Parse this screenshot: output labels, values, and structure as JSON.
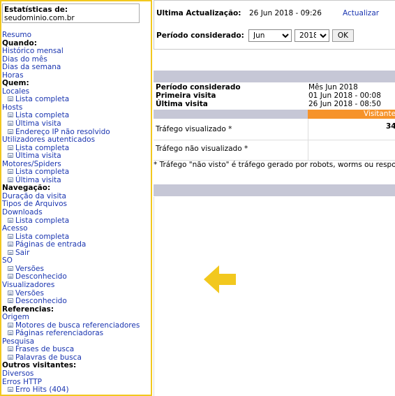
{
  "nav": {
    "title": "Estatísticas de:",
    "site": "seudominio.com.br",
    "items": [
      {
        "t": "Resumo",
        "k": "link"
      },
      {
        "t": "Quando:",
        "k": "h"
      },
      {
        "t": "Histórico mensal",
        "k": "link"
      },
      {
        "t": "Dias do mês",
        "k": "link"
      },
      {
        "t": "Dias da semana",
        "k": "link"
      },
      {
        "t": "Horas",
        "k": "link"
      },
      {
        "t": "Quem:",
        "k": "h"
      },
      {
        "t": "Locales",
        "k": "link"
      },
      {
        "t": "Lista completa",
        "k": "sub"
      },
      {
        "t": "Hosts",
        "k": "link"
      },
      {
        "t": "Lista completa",
        "k": "sub"
      },
      {
        "t": "Última visita",
        "k": "sub"
      },
      {
        "t": "Endereço IP não resolvido",
        "k": "sub"
      },
      {
        "t": "Utilizadores autenticados",
        "k": "link"
      },
      {
        "t": "Lista completa",
        "k": "sub"
      },
      {
        "t": "Última visita",
        "k": "sub"
      },
      {
        "t": "Motores/Spiders",
        "k": "link"
      },
      {
        "t": "Lista completa",
        "k": "sub"
      },
      {
        "t": "Última visita",
        "k": "sub"
      },
      {
        "t": "Navegação:",
        "k": "h"
      },
      {
        "t": "Duração da visita",
        "k": "link"
      },
      {
        "t": "Tipos de Arquivos",
        "k": "link"
      },
      {
        "t": "Downloads",
        "k": "link"
      },
      {
        "t": "Lista completa",
        "k": "sub"
      },
      {
        "t": "Acesso",
        "k": "link"
      },
      {
        "t": "Lista completa",
        "k": "sub"
      },
      {
        "t": "Páginas de entrada",
        "k": "sub"
      },
      {
        "t": "Sair",
        "k": "sub"
      },
      {
        "t": "SO",
        "k": "link"
      },
      {
        "t": "Versões",
        "k": "sub"
      },
      {
        "t": "Desconhecido",
        "k": "sub"
      },
      {
        "t": "Visualizadores",
        "k": "link"
      },
      {
        "t": "Versões",
        "k": "sub"
      },
      {
        "t": "Desconhecido",
        "k": "sub"
      },
      {
        "t": "Referencias:",
        "k": "h"
      },
      {
        "t": "Origem",
        "k": "link"
      },
      {
        "t": "Motores de busca referenciadores",
        "k": "sub"
      },
      {
        "t": "Páginas referenciadoras",
        "k": "sub"
      },
      {
        "t": "Pesquisa",
        "k": "link"
      },
      {
        "t": "Frases de busca",
        "k": "sub"
      },
      {
        "t": "Palavras de busca",
        "k": "sub"
      },
      {
        "t": "Outros visitantes:",
        "k": "h"
      },
      {
        "t": "Diversos",
        "k": "link"
      },
      {
        "t": "Erros HTTP",
        "k": "link"
      },
      {
        "t": "Erro Hits (404)",
        "k": "sub"
      }
    ]
  },
  "header": {
    "last_update_label": "Ultima Actualização:",
    "last_update_value": "26 Jun 2018 - 09:26",
    "update_link": "Actualizar",
    "period_label": "Período considerado:",
    "month_value": "Jun",
    "year_value": "2018",
    "ok_label": "OK"
  },
  "summary": {
    "period_label": "Período considerado",
    "period_value": "Mês Jun 2018",
    "first_visit_label": "Primeira visita",
    "first_visit_value": "01 Jun 2018 - 00:08",
    "last_visit_label": "Última visita",
    "last_visit_value": "26 Jun 2018 - 08:50",
    "visitors_header": "Visitante",
    "viewed_traffic_label": "Tráfego visualizado *",
    "viewed_traffic_value": "34",
    "not_viewed_traffic_label": "Tráfego não visualizado *",
    "footnote": "* Tráfego \"não visto\" é tráfego gerado por robots, worms ou respostas"
  },
  "colors": {
    "highlight_border": "#f2c81e",
    "arrow": "#f2c81e",
    "band": "#c6c7d6",
    "visitor_header": "#f6932a",
    "link": "#1a35b0"
  }
}
